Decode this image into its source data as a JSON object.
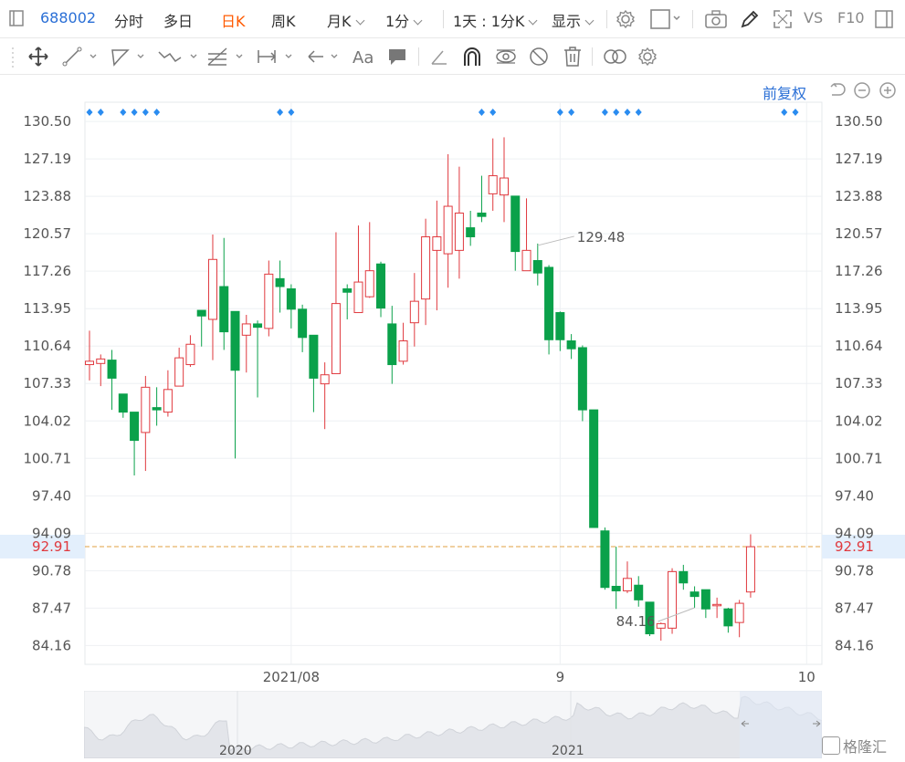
{
  "toolbar": {
    "code": "688002",
    "tabs": [
      {
        "label": "分时",
        "active": false
      },
      {
        "label": "多日",
        "active": false
      },
      {
        "label": "日K",
        "active": true
      },
      {
        "label": "周K",
        "active": false
      },
      {
        "label": "月K",
        "active": false
      },
      {
        "label": "1分",
        "active": false
      },
      {
        "label": "1天 : 1分K",
        "active": false
      },
      {
        "label": "显示",
        "active": false
      }
    ],
    "vs_label": "VS",
    "f10_label": "F10"
  },
  "draw_tools": [
    "move-icon",
    "line-icon",
    "polygon-icon",
    "wave-icon",
    "fib-icon",
    "range-icon",
    "arrow-icon",
    "text-icon",
    "note-icon",
    "angle-icon",
    "magnet-icon",
    "eye-icon",
    "hide-icon",
    "trash-icon",
    "compare-icon",
    "settings-icon"
  ],
  "adjust_label": "前复权",
  "colors": {
    "up": "#e0393e",
    "down": "#0aa14a",
    "accent": "#2a6fd6",
    "current": "#e0393e",
    "grid": "#eef0f3"
  },
  "chart_data": {
    "type": "candlestick",
    "ylim": [
      82.5,
      132.2
    ],
    "yticks": [
      130.5,
      127.19,
      123.88,
      120.57,
      117.26,
      113.95,
      110.64,
      107.33,
      104.02,
      100.71,
      97.4,
      94.09,
      90.78,
      87.47,
      84.16
    ],
    "ytick_labels": [
      "130.50",
      "127.19",
      "123.88",
      "120.57",
      "117.26",
      "113.95",
      "110.64",
      "107.33",
      "104.02",
      "100.71",
      "97.40",
      "94.09",
      "90.78",
      "87.47",
      "84.16"
    ],
    "xticks": [
      {
        "label": "2021/08",
        "index": 18
      },
      {
        "label": "9",
        "index": 42
      },
      {
        "label": "10",
        "index": 64
      }
    ],
    "current_price": 92.91,
    "current_price_label": "92.91",
    "high_label": "129.48",
    "low_label": "84.16",
    "high_index": 40,
    "low_index": 54,
    "candles": [
      [
        109.0,
        109.3,
        112.0,
        107.6
      ],
      [
        109.1,
        109.5,
        109.9,
        107.1
      ],
      [
        109.4,
        107.8,
        110.3,
        105.0
      ],
      [
        106.4,
        104.8,
        106.4,
        104.3
      ],
      [
        104.8,
        102.3,
        104.8,
        99.2
      ],
      [
        103.0,
        107.0,
        108.0,
        99.6
      ],
      [
        105.2,
        105.0,
        107.0,
        103.6
      ],
      [
        104.8,
        106.8,
        108.5,
        104.4
      ],
      [
        107.1,
        109.6,
        110.5,
        107.1
      ],
      [
        109.0,
        110.8,
        111.6,
        108.8
      ],
      [
        113.8,
        113.3,
        113.8,
        110.6
      ],
      [
        113.0,
        118.3,
        120.5,
        109.4
      ],
      [
        115.9,
        111.9,
        120.2,
        110.3
      ],
      [
        113.7,
        108.5,
        113.7,
        100.7
      ],
      [
        111.6,
        112.6,
        113.4,
        108.3
      ],
      [
        112.6,
        112.3,
        112.9,
        106.1
      ],
      [
        112.2,
        117.0,
        118.2,
        111.5
      ],
      [
        116.6,
        115.9,
        118.2,
        113.6
      ],
      [
        115.7,
        113.9,
        116.1,
        112.2
      ],
      [
        113.9,
        111.4,
        114.3,
        110.1
      ],
      [
        111.6,
        107.8,
        111.6,
        104.8
      ],
      [
        107.3,
        108.1,
        109.2,
        103.3
      ],
      [
        108.2,
        114.4,
        120.7,
        108.2
      ],
      [
        115.7,
        115.4,
        116.1,
        113.0
      ],
      [
        113.6,
        116.3,
        121.3,
        113.6
      ],
      [
        115.0,
        117.3,
        121.6,
        114.9
      ],
      [
        117.9,
        114.0,
        118.1,
        113.2
      ],
      [
        112.6,
        109.0,
        114.2,
        107.3
      ],
      [
        109.3,
        111.1,
        112.7,
        109.0
      ],
      [
        112.7,
        114.6,
        117.1,
        110.6
      ],
      [
        114.8,
        120.3,
        121.9,
        112.5
      ],
      [
        119.1,
        120.3,
        123.5,
        113.8
      ],
      [
        118.8,
        123.0,
        127.6,
        115.8
      ],
      [
        119.1,
        122.4,
        126.5,
        116.6
      ],
      [
        121.1,
        120.3,
        122.6,
        119.5
      ],
      [
        122.4,
        122.1,
        125.7,
        121.6
      ],
      [
        124.1,
        125.7,
        129.0,
        122.6
      ],
      [
        124.0,
        125.5,
        129.1,
        121.6
      ],
      [
        123.9,
        119.0,
        123.9,
        117.3
      ],
      [
        117.3,
        119.1,
        123.7,
        117.3
      ],
      [
        118.2,
        117.1,
        119.7,
        116.0
      ],
      [
        117.6,
        111.2,
        117.8,
        109.9
      ],
      [
        113.6,
        111.2,
        113.7,
        110.2
      ],
      [
        111.1,
        110.4,
        111.7,
        109.5
      ],
      [
        110.5,
        105.0,
        110.7,
        104.0
      ],
      [
        105.0,
        94.6,
        105.0,
        94.6
      ],
      [
        94.3,
        89.3,
        94.6,
        89.1
      ],
      [
        89.4,
        89.0,
        92.9,
        87.4
      ],
      [
        89.0,
        90.1,
        91.6,
        88.8
      ],
      [
        89.5,
        88.2,
        90.3,
        87.6
      ],
      [
        88.0,
        85.2,
        88.0,
        85.0
      ],
      [
        85.7,
        86.1,
        86.2,
        84.6
      ],
      [
        85.7,
        90.7,
        91.0,
        85.2
      ],
      [
        90.7,
        89.7,
        91.3,
        89.1
      ],
      [
        88.9,
        88.5,
        89.4,
        87.5
      ],
      [
        89.1,
        87.4,
        89.1,
        86.6
      ],
      [
        87.8,
        87.8,
        88.4,
        86.6
      ],
      [
        87.4,
        85.9,
        87.5,
        85.3
      ],
      [
        86.2,
        87.9,
        88.2,
        84.9
      ],
      [
        88.9,
        92.9,
        94.0,
        88.4
      ]
    ]
  },
  "navigator": {
    "year_labels": [
      "2020",
      "2021"
    ]
  },
  "watermark": "格隆汇"
}
